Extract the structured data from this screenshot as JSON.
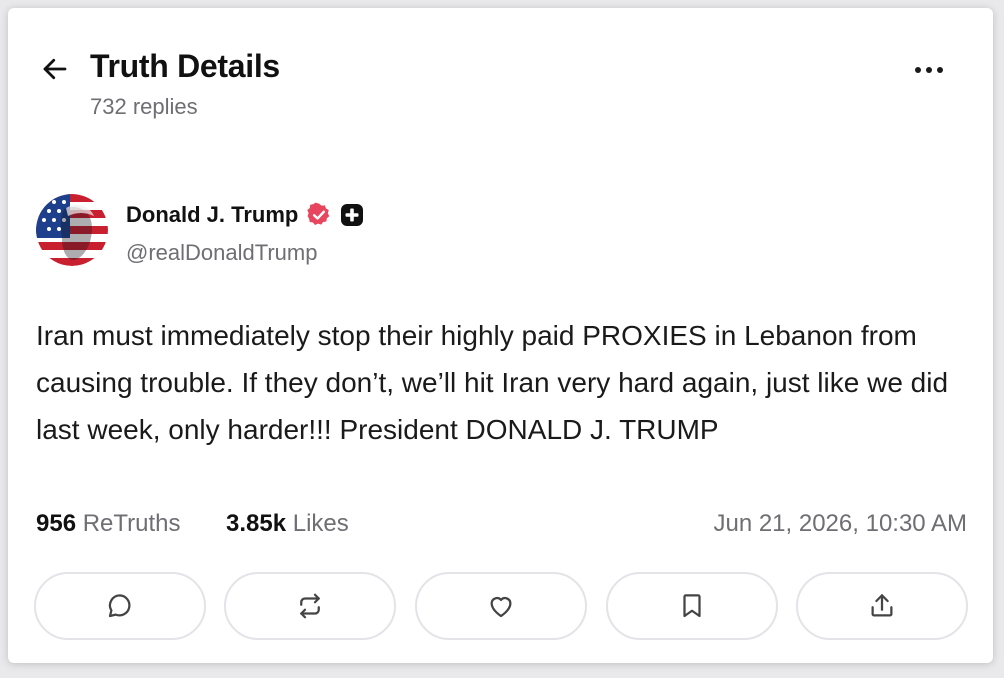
{
  "header": {
    "title": "Truth Details",
    "reply_count": "732 replies",
    "back_icon": "arrow-left-icon",
    "more_icon": "ellipsis-icon"
  },
  "post": {
    "author": {
      "display_name": "Donald J. Trump",
      "handle": "@realDonaldTrump",
      "verified_icon": "verified-badge-icon",
      "verified_color": "#e8465f",
      "plus_icon": "plus-badge-icon"
    },
    "text": "Iran must immediately stop their highly paid PROXIES in Lebanon from causing trouble. If they don’t, we’ll hit Iran very hard again, just like we did last week, only harder!!! President  DONALD J. TRUMP",
    "stats": {
      "retruths_count": "956",
      "retruths_label": "ReTruths",
      "likes_count": "3.85k",
      "likes_label": "Likes",
      "timestamp": "Jun 21, 2026, 10:30 AM"
    }
  },
  "actions": [
    {
      "name": "reply",
      "icon": "comment-icon"
    },
    {
      "name": "retruth",
      "icon": "repost-icon"
    },
    {
      "name": "like",
      "icon": "heart-icon"
    },
    {
      "name": "bookmark",
      "icon": "bookmark-icon"
    },
    {
      "name": "share",
      "icon": "share-icon"
    }
  ],
  "colors": {
    "text_primary": "#111111",
    "text_secondary": "#6e6e73",
    "button_border": "#e3e3e8"
  }
}
